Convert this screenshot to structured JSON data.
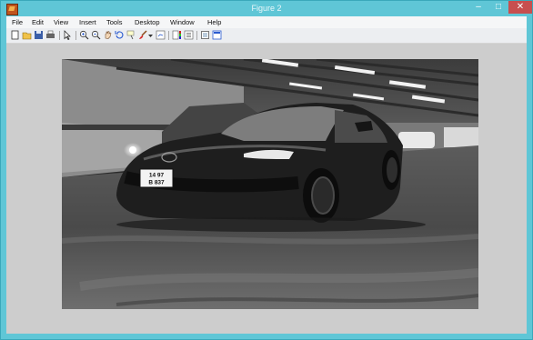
{
  "window": {
    "title": "Figure 2",
    "controls": {
      "minimize": "–",
      "maximize": "□",
      "close": "✕"
    }
  },
  "menu": {
    "items": [
      "File",
      "Edit",
      "View",
      "Insert",
      "Tools",
      "Desktop",
      "Window",
      "Help"
    ]
  },
  "toolbar": {
    "icons": [
      "new-figure-icon",
      "open-file-icon",
      "save-figure-icon",
      "print-figure-icon",
      "edit-plot-icon",
      "zoom-in-icon",
      "zoom-out-icon",
      "pan-icon",
      "rotate-3d-icon",
      "data-cursor-icon",
      "brush-icon",
      "brush-dropdown-icon",
      "link-plot-icon",
      "insert-colorbar-icon",
      "insert-legend-icon",
      "hide-plot-tools-icon",
      "show-plot-tools-icon"
    ]
  },
  "figure": {
    "image_subject": "grayscale photo of a sports car in a parking garage",
    "plate": {
      "line1": "14  97",
      "line2": "B  837"
    }
  },
  "colors": {
    "title_bar": "#5fc6d6",
    "close_button": "#c74f4f",
    "figure_background": "#cdcdcd",
    "menu_background": "#f5f6f7"
  }
}
